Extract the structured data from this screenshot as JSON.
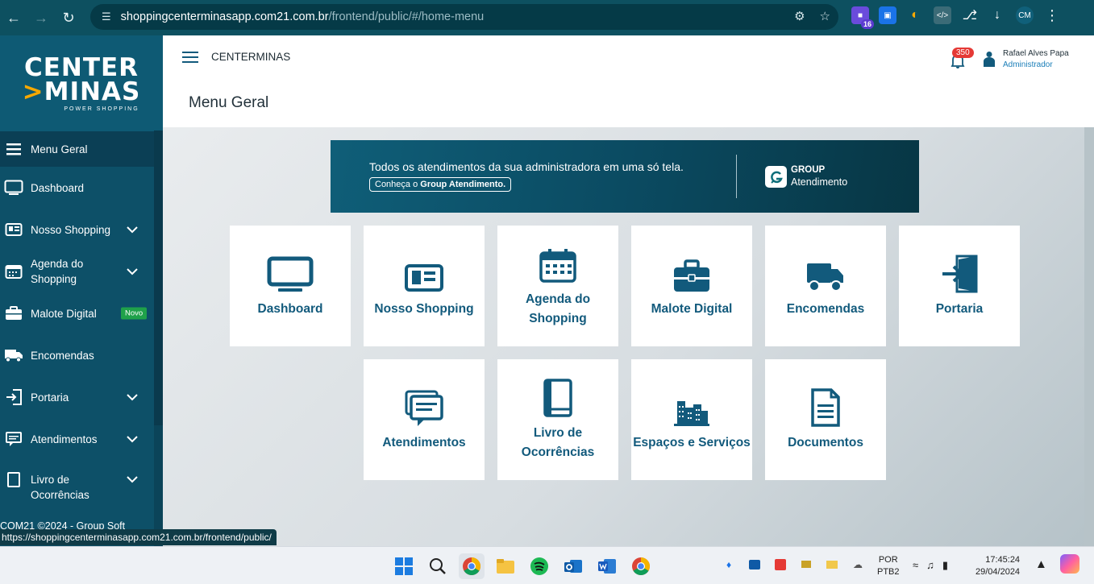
{
  "browser": {
    "url_host": "shoppingcenterminasapp.com21.com.br",
    "url_path": "/frontend/public/#/home-menu",
    "ext_badge": "16"
  },
  "sidebar": {
    "logo_line1": "CENTER",
    "logo_line2": "MINAS",
    "logo_sub": "POWER SHOPPING",
    "items": [
      {
        "label": "Menu Geral"
      },
      {
        "label": "Dashboard"
      },
      {
        "label": "Nosso Shopping"
      },
      {
        "label": "Agenda do Shopping"
      },
      {
        "label": "Malote Digital",
        "badge": "Novo"
      },
      {
        "label": "Encomendas"
      },
      {
        "label": "Portaria"
      },
      {
        "label": "Atendimentos"
      },
      {
        "label": "Livro de Ocorrências"
      }
    ],
    "footer": "COM21 ©2024 - Group Soft"
  },
  "header": {
    "brand": "CENTERMINAS",
    "page_title": "Menu Geral",
    "notif_count": "350",
    "user_name": "Rafael Alves Papa",
    "user_role": "Administrador"
  },
  "banner": {
    "text": "Todos os atendimentos da sua administradora em uma só tela.",
    "cta_prefix": "Conheça o ",
    "cta_bold": "Group Atendimento.",
    "group_line1": "GROUP",
    "group_line2": "Atendimento"
  },
  "tiles": [
    {
      "label": "Dashboard",
      "icon": "monitor-icon"
    },
    {
      "label": "Nosso Shopping",
      "icon": "newspaper-icon"
    },
    {
      "label": "Agenda do Shopping",
      "icon": "calendar-icon"
    },
    {
      "label": "Malote Digital",
      "icon": "briefcase-icon"
    },
    {
      "label": "Encomendas",
      "icon": "truck-icon"
    },
    {
      "label": "Portaria",
      "icon": "door-enter-icon"
    },
    {
      "label": "Atendimentos",
      "icon": "chat-icon"
    },
    {
      "label": "Livro de Ocorrências",
      "icon": "book-icon"
    },
    {
      "label": "Espaços e Serviços",
      "icon": "factory-icon"
    },
    {
      "label": "Documentos",
      "icon": "document-icon"
    }
  ],
  "status_url": "https://shoppingcenterminasapp.com21.com.br/frontend/public/",
  "taskbar": {
    "lang1": "POR",
    "lang2": "PTB2",
    "time": "17:45:24",
    "date": "29/04/2024"
  },
  "colors": {
    "sidebar": "#0d5068",
    "accent": "#125a7c",
    "logo_accent": "#f7a800",
    "badge_red": "#e53935",
    "novo_green": "#1fa14a"
  }
}
